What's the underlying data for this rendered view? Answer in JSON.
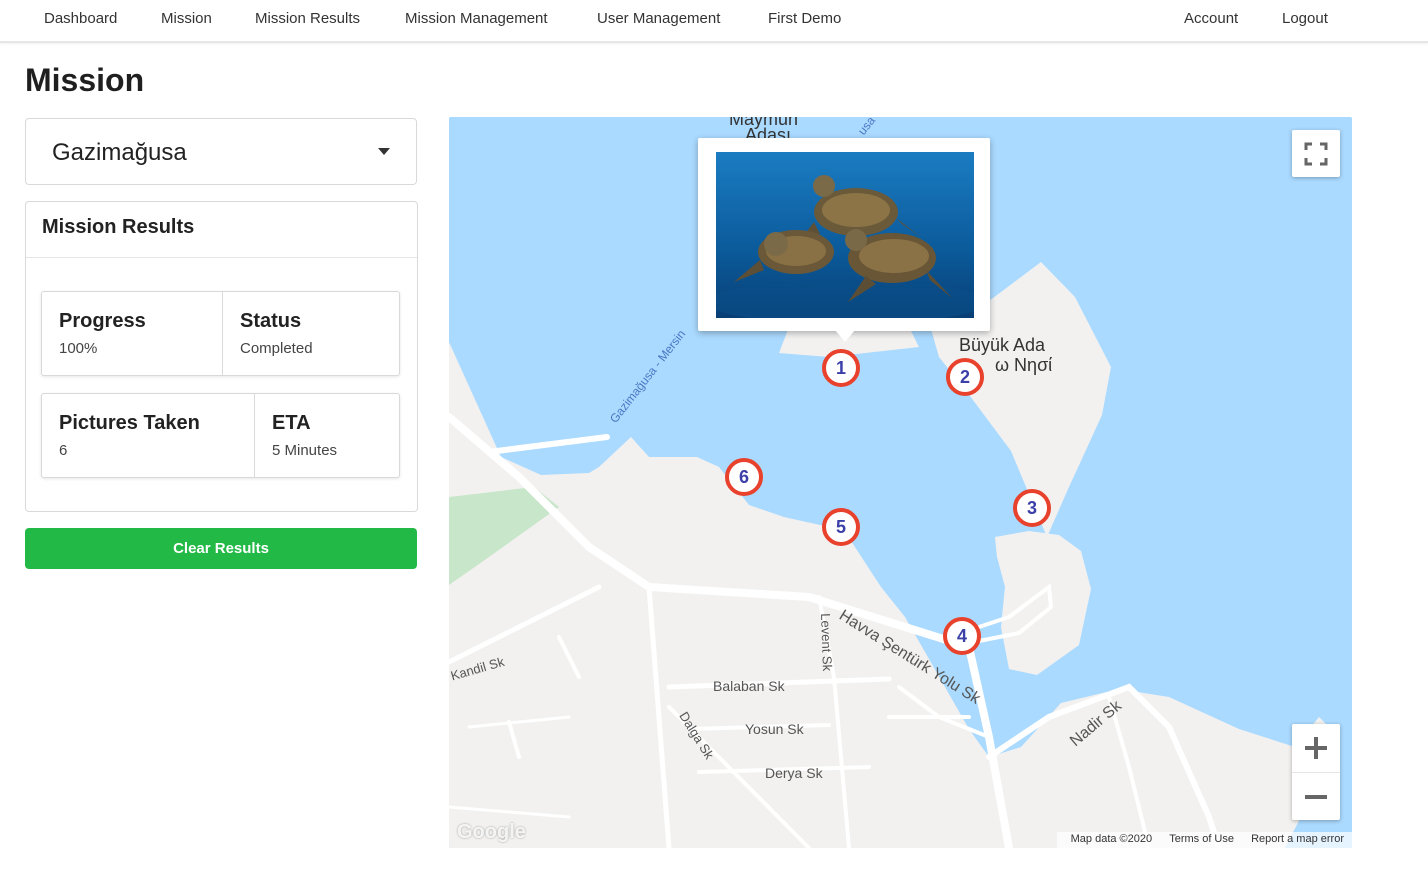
{
  "nav": {
    "links": [
      "Dashboard",
      "Mission",
      "Mission Results",
      "Mission Management",
      "User Management",
      "First Demo"
    ],
    "account": "Account",
    "logout": "Logout"
  },
  "page": {
    "title": "Mission"
  },
  "mission_select": {
    "value": "Gazimağusa"
  },
  "results_card": {
    "title": "Mission Results",
    "progress_label": "Progress",
    "progress_value": "100%",
    "status_label": "Status",
    "status_value": "Completed",
    "pictures_label": "Pictures Taken",
    "pictures_value": "6",
    "eta_label": "ETA",
    "eta_value": "5 Minutes"
  },
  "clear_button": {
    "label": "Clear Results",
    "color": "#22b946"
  },
  "map": {
    "water_color": "#aadaff",
    "land_color": "#f2f1f0",
    "marker_color": "#e8412c",
    "markers": [
      "1",
      "2",
      "3",
      "4",
      "5",
      "6"
    ],
    "labels": {
      "island_name_1": "Büyük Ada",
      "island_name_2": "ω Νησί",
      "top_partial": "Maymun",
      "top_partial_2": "Adası",
      "ferry_route": "Gazimağusa - Mersin",
      "ferry_route_partial": "usa",
      "street_havva": "Havva Şentürk Yolu Sk",
      "street_nadir": "Nadir Sk",
      "street_kandil": "Kandil Sk",
      "street_balaban": "Balaban Sk",
      "street_levent": "Levent Sk",
      "street_yosun": "Yosun Sk",
      "street_dalga": "Dalga Sk",
      "street_derya": "Derya Sk"
    },
    "attribution": {
      "map_data": "Map data ©2020",
      "terms": "Terms of Use",
      "report": "Report a map error"
    },
    "google_logo": "Google",
    "icons": {
      "fullscreen": "fullscreen-icon",
      "zoom_in": "plus-icon",
      "zoom_out": "minus-icon"
    }
  }
}
